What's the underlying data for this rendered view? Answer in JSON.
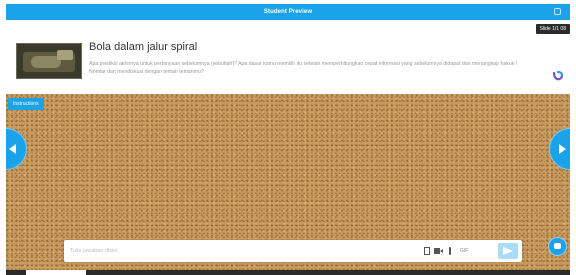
{
  "topbar": {
    "title": "Student Preview"
  },
  "slide": {
    "badge": "Slide 1/1 08"
  },
  "card": {
    "title": "Bola dalam jalur spiral",
    "description": "Apa prediksi akhirnya untuk pertanyaan sebelumnya (sebutlah)? Apa dasar kamu memilih itu setelah memperhitungkan cepat informasi yang sebelumnya didapat dan menangkap hakuk ! Nomlar dan mendiskusi dengan teman temanmu?"
  },
  "board": {
    "instructions_label": "Instructions"
  },
  "reply": {
    "placeholder": "Tulis jawaban disini",
    "gif_label": "GIF"
  },
  "icons": {
    "settings": "square-icon",
    "prev": "chevron-left-icon",
    "next": "chevron-right-icon",
    "file": "file-icon",
    "video": "video-icon",
    "link": "link-icon",
    "send": "send-icon",
    "help": "chat-icon",
    "logo": "brand-logo-icon"
  },
  "colors": {
    "accent": "#1aa3e8",
    "board": "#c99a5e"
  }
}
